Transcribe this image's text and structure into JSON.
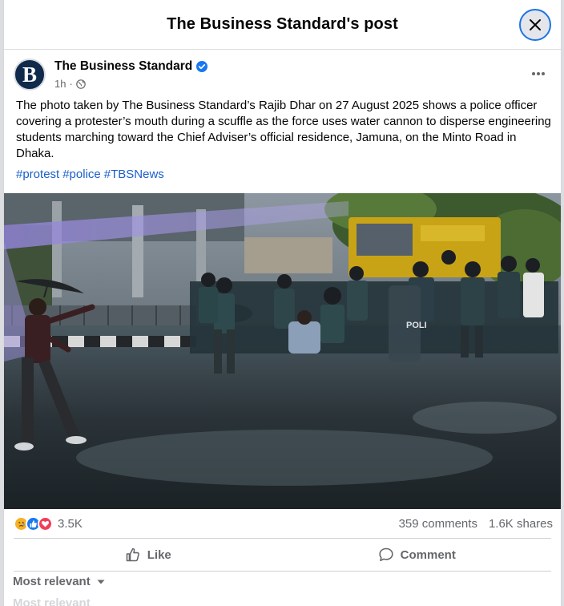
{
  "dialog": {
    "title": "The Business Standard's post"
  },
  "post": {
    "author": "The Business Standard",
    "avatar_letter": "B",
    "time": "1h",
    "separator": "·",
    "caption": "The photo taken by The Business Standard’s Rajib Dhar on 27 August 2025 shows a police officer covering a protester’s mouth during a scuffle as the force uses water cannon to disperse engineering students marching toward the Chief Adviser’s official residence, Jamuna, on the Minto Road in Dhaka.",
    "hashtags": [
      "#protest",
      "#police",
      "#TBSNews"
    ]
  },
  "photo": {
    "truck_text": "",
    "shield_text": "POLI"
  },
  "stats": {
    "reaction_count": "3.5K",
    "comments": "359 comments",
    "shares": "1.6K shares"
  },
  "actions": {
    "like": "Like",
    "comment": "Comment"
  },
  "comments_sort": {
    "label": "Most relevant",
    "ghost": "Most relevant"
  },
  "colors": {
    "accent": "#1877f2",
    "verified": "#1877f2",
    "love": "#f33e58",
    "sad": "#f7b125"
  },
  "icons": [
    "close-icon",
    "verified-icon",
    "globe-icon",
    "more-icon",
    "sad-reaction-icon",
    "like-reaction-icon",
    "love-reaction-icon",
    "like-icon",
    "comment-icon",
    "caret-down-icon"
  ]
}
